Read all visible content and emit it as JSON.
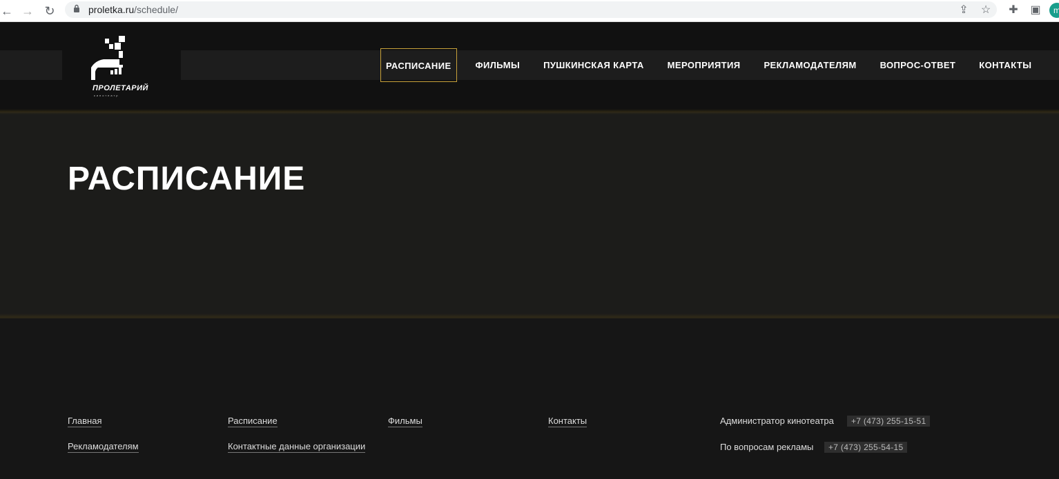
{
  "browser": {
    "url_host": "proletka.ru",
    "url_path": "/schedule/",
    "profile_initial": "m"
  },
  "header": {
    "logo_text": "ПРОЛЕТАРИЙ",
    "logo_sub": "кинотеатр",
    "nav": [
      {
        "label": "РАСПИСАНИЕ",
        "active": true
      },
      {
        "label": "ФИЛЬМЫ"
      },
      {
        "label": "ПУШКИНСКАЯ КАРТА"
      },
      {
        "label": "МЕРОПРИЯТИЯ"
      },
      {
        "label": "РЕКЛАМОДАТЕЛЯМ"
      },
      {
        "label": "ВОПРОС-ОТВЕТ"
      },
      {
        "label": "КОНТАКТЫ"
      }
    ]
  },
  "hero": {
    "title": "РАСПИСАНИЕ"
  },
  "footer": {
    "links": [
      "Главная",
      "Расписание",
      "Фильмы",
      "Контакты",
      "Рекламодателям",
      "Контактные данные организации"
    ],
    "contacts": [
      {
        "label": "Администратор кинотеатра",
        "phone": "+7 (473) 255-15-51"
      },
      {
        "label": "По вопросам рекламы",
        "phone": "+7 (473) 255-54-15"
      }
    ]
  },
  "colors": {
    "accent": "#c8a23a",
    "background": "#161616",
    "header": "#111111"
  }
}
